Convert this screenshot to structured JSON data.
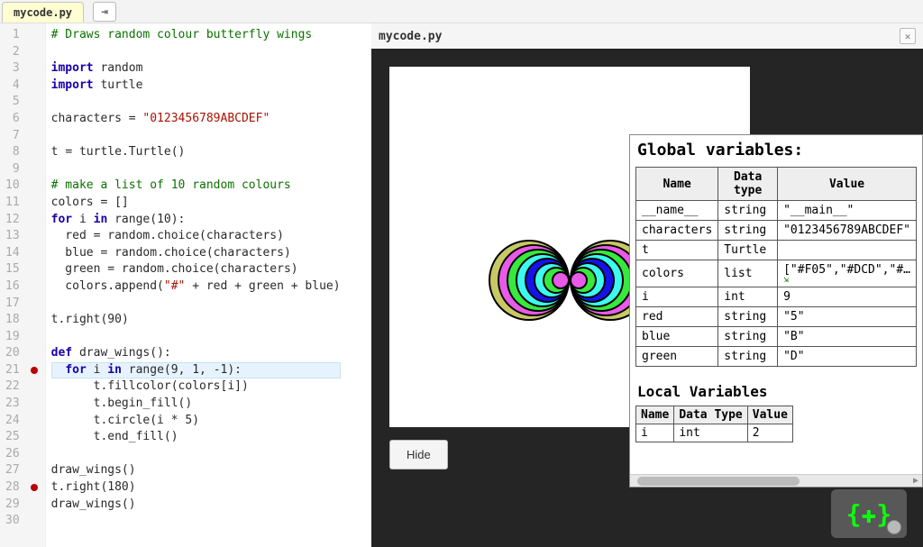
{
  "tab": {
    "filename": "mycode.py"
  },
  "run_icon_label": "⇥",
  "output": {
    "title": "mycode.py",
    "close_label": "✕",
    "hide_label": "Hide"
  },
  "bottom_gadget_label": "{✚}",
  "code": {
    "lines": [
      {
        "n": 1,
        "spans": [
          {
            "t": "# Draws random colour butterfly wings",
            "c": "cm-comment"
          }
        ]
      },
      {
        "n": 2,
        "spans": [
          {
            "t": " "
          }
        ]
      },
      {
        "n": 3,
        "spans": [
          {
            "t": "import",
            "c": "cm-keyword"
          },
          {
            "t": " random",
            "c": "cm-var"
          }
        ]
      },
      {
        "n": 4,
        "spans": [
          {
            "t": "import",
            "c": "cm-keyword"
          },
          {
            "t": " turtle",
            "c": "cm-var"
          }
        ]
      },
      {
        "n": 5,
        "spans": [
          {
            "t": " "
          }
        ]
      },
      {
        "n": 6,
        "spans": [
          {
            "t": "characters ",
            "c": "cm-var"
          },
          {
            "t": "=",
            "c": "cm-op"
          },
          {
            "t": " "
          },
          {
            "t": "\"0123456789ABCDEF\"",
            "c": "cm-str"
          }
        ]
      },
      {
        "n": 7,
        "spans": [
          {
            "t": " "
          }
        ]
      },
      {
        "n": 8,
        "spans": [
          {
            "t": "t ",
            "c": "cm-var"
          },
          {
            "t": "=",
            "c": "cm-op"
          },
          {
            "t": " turtle.Turtle()",
            "c": "cm-var"
          }
        ]
      },
      {
        "n": 9,
        "spans": [
          {
            "t": " "
          }
        ]
      },
      {
        "n": 10,
        "spans": [
          {
            "t": "# make a list of 10 random colours",
            "c": "cm-comment"
          }
        ]
      },
      {
        "n": 11,
        "spans": [
          {
            "t": "colors ",
            "c": "cm-var"
          },
          {
            "t": "=",
            "c": "cm-op"
          },
          {
            "t": " []",
            "c": "cm-op"
          }
        ]
      },
      {
        "n": 12,
        "spans": [
          {
            "t": "for",
            "c": "cm-keyword"
          },
          {
            "t": " i ",
            "c": "cm-var"
          },
          {
            "t": "in",
            "c": "cm-keyword"
          },
          {
            "t": " ",
            "c": ""
          },
          {
            "t": "range",
            "c": "cm-builtin"
          },
          {
            "t": "(",
            "c": "cm-op"
          },
          {
            "t": "10",
            "c": "cm-num"
          },
          {
            "t": "):",
            "c": "cm-op"
          }
        ]
      },
      {
        "n": 13,
        "spans": [
          {
            "t": "  red ",
            "c": "cm-var"
          },
          {
            "t": "=",
            "c": "cm-op"
          },
          {
            "t": " random.choice(characters)",
            "c": "cm-var"
          }
        ]
      },
      {
        "n": 14,
        "spans": [
          {
            "t": "  blue ",
            "c": "cm-var"
          },
          {
            "t": "=",
            "c": "cm-op"
          },
          {
            "t": " random.choice(characters)",
            "c": "cm-var"
          }
        ]
      },
      {
        "n": 15,
        "spans": [
          {
            "t": "  green ",
            "c": "cm-var"
          },
          {
            "t": "=",
            "c": "cm-op"
          },
          {
            "t": " random.choice(characters)",
            "c": "cm-var"
          }
        ]
      },
      {
        "n": 16,
        "spans": [
          {
            "t": "  colors.append(",
            "c": "cm-var"
          },
          {
            "t": "\"#\"",
            "c": "cm-str"
          },
          {
            "t": " + red + green + blue)",
            "c": "cm-var"
          }
        ]
      },
      {
        "n": 17,
        "spans": [
          {
            "t": " "
          }
        ]
      },
      {
        "n": 18,
        "spans": [
          {
            "t": "t.right(",
            "c": "cm-var"
          },
          {
            "t": "90",
            "c": "cm-num"
          },
          {
            "t": ")",
            "c": "cm-op"
          }
        ]
      },
      {
        "n": 19,
        "spans": [
          {
            "t": " "
          }
        ]
      },
      {
        "n": 20,
        "spans": [
          {
            "t": "def",
            "c": "cm-keyword"
          },
          {
            "t": " ",
            "c": ""
          },
          {
            "t": "draw_wings",
            "c": "cm-def"
          },
          {
            "t": "():",
            "c": "cm-op"
          }
        ]
      },
      {
        "n": 21,
        "hl": true,
        "bp": true,
        "spans": [
          {
            "t": "  "
          },
          {
            "t": "for",
            "c": "cm-keyword"
          },
          {
            "t": " i ",
            "c": "cm-var"
          },
          {
            "t": "in",
            "c": "cm-keyword"
          },
          {
            "t": " ",
            "c": ""
          },
          {
            "t": "range",
            "c": "cm-builtin"
          },
          {
            "t": "(",
            "c": "cm-op"
          },
          {
            "t": "9",
            "c": "cm-num"
          },
          {
            "t": ", ",
            "c": "cm-op"
          },
          {
            "t": "1",
            "c": "cm-num"
          },
          {
            "t": ", -",
            "c": "cm-op"
          },
          {
            "t": "1",
            "c": "cm-num"
          },
          {
            "t": "):",
            "c": "cm-op"
          }
        ]
      },
      {
        "n": 22,
        "spans": [
          {
            "t": "      t.fillcolor(colors[i])",
            "c": "cm-var"
          }
        ]
      },
      {
        "n": 23,
        "spans": [
          {
            "t": "      t.begin_fill()",
            "c": "cm-var"
          }
        ]
      },
      {
        "n": 24,
        "spans": [
          {
            "t": "      t.circle(i * ",
            "c": "cm-var"
          },
          {
            "t": "5",
            "c": "cm-num"
          },
          {
            "t": ")",
            "c": "cm-op"
          }
        ]
      },
      {
        "n": 25,
        "spans": [
          {
            "t": "      t.end_fill()",
            "c": "cm-var"
          }
        ]
      },
      {
        "n": 26,
        "spans": [
          {
            "t": " "
          }
        ]
      },
      {
        "n": 27,
        "spans": [
          {
            "t": "draw_wings()",
            "c": "cm-var"
          }
        ]
      },
      {
        "n": 28,
        "bp": true,
        "spans": [
          {
            "t": "t.right(",
            "c": "cm-var"
          },
          {
            "t": "180",
            "c": "cm-num"
          },
          {
            "t": ")",
            "c": "cm-op"
          }
        ]
      },
      {
        "n": 29,
        "spans": [
          {
            "t": "draw_wings()",
            "c": "cm-var"
          }
        ]
      },
      {
        "n": 30,
        "spans": [
          {
            "t": " "
          }
        ]
      }
    ]
  },
  "vars": {
    "global_title": "Global variables:",
    "headers": {
      "name": "Name",
      "type": "Data type",
      "value": "Value"
    },
    "globals": [
      {
        "name": "__name__",
        "type": "string",
        "value": "\"__main__\""
      },
      {
        "name": "characters",
        "type": "string",
        "value": "\"0123456789ABCDEF\""
      },
      {
        "name": "t",
        "type": "Turtle",
        "value": ""
      },
      {
        "name": "colors",
        "type": "list",
        "value": "[\"#F05\",\"#DCD\",\"#…",
        "expand": true
      },
      {
        "name": "i",
        "type": "int",
        "value": "9"
      },
      {
        "name": "red",
        "type": "string",
        "value": "\"5\""
      },
      {
        "name": "blue",
        "type": "string",
        "value": "\"B\""
      },
      {
        "name": "green",
        "type": "string",
        "value": "\"D\""
      }
    ],
    "local_title": "Local Variables",
    "local_headers": {
      "name": "Name",
      "type": "Data Type",
      "value": "Value"
    },
    "locals": [
      {
        "name": "i",
        "type": "int",
        "value": "2"
      }
    ]
  },
  "butterfly_colors": [
    "#c8c864",
    "#e85ae8",
    "#38e83d",
    "#3dfaef",
    "#1414e8",
    "#3dfaef",
    "#38e83d",
    "#e85ae8",
    "#ee873b"
  ]
}
